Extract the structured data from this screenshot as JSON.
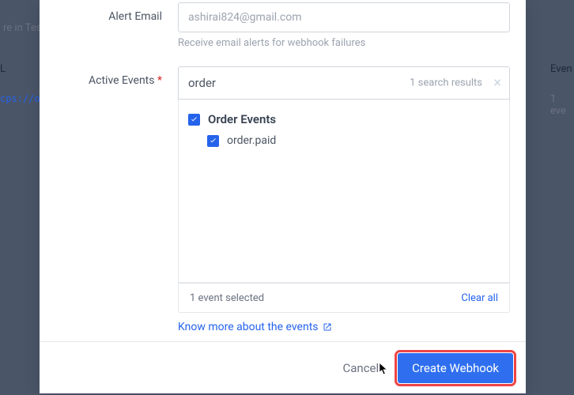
{
  "background": {
    "test_label": "re in Test",
    "col_label": "L",
    "url_hint": "cps://o",
    "right_label": "Even",
    "right_count": "1 eve"
  },
  "form": {
    "alert_email": {
      "label": "Alert Email",
      "placeholder": "ashirai824@gmail.com",
      "value": "",
      "helper": "Receive email alerts for webhook failures"
    },
    "active_events": {
      "label": "Active Events",
      "required": "*",
      "search_value": "order",
      "search_results": "1 search results",
      "clear_icon": "×",
      "group": {
        "label": "Order Events",
        "checked": true,
        "items": [
          {
            "label": "order.paid",
            "checked": true
          }
        ]
      },
      "selected_text": "1 event selected",
      "clear_all": "Clear all",
      "know_more": "Know more about the events"
    }
  },
  "footer": {
    "cancel": "Cancel",
    "create": "Create Webhook"
  }
}
